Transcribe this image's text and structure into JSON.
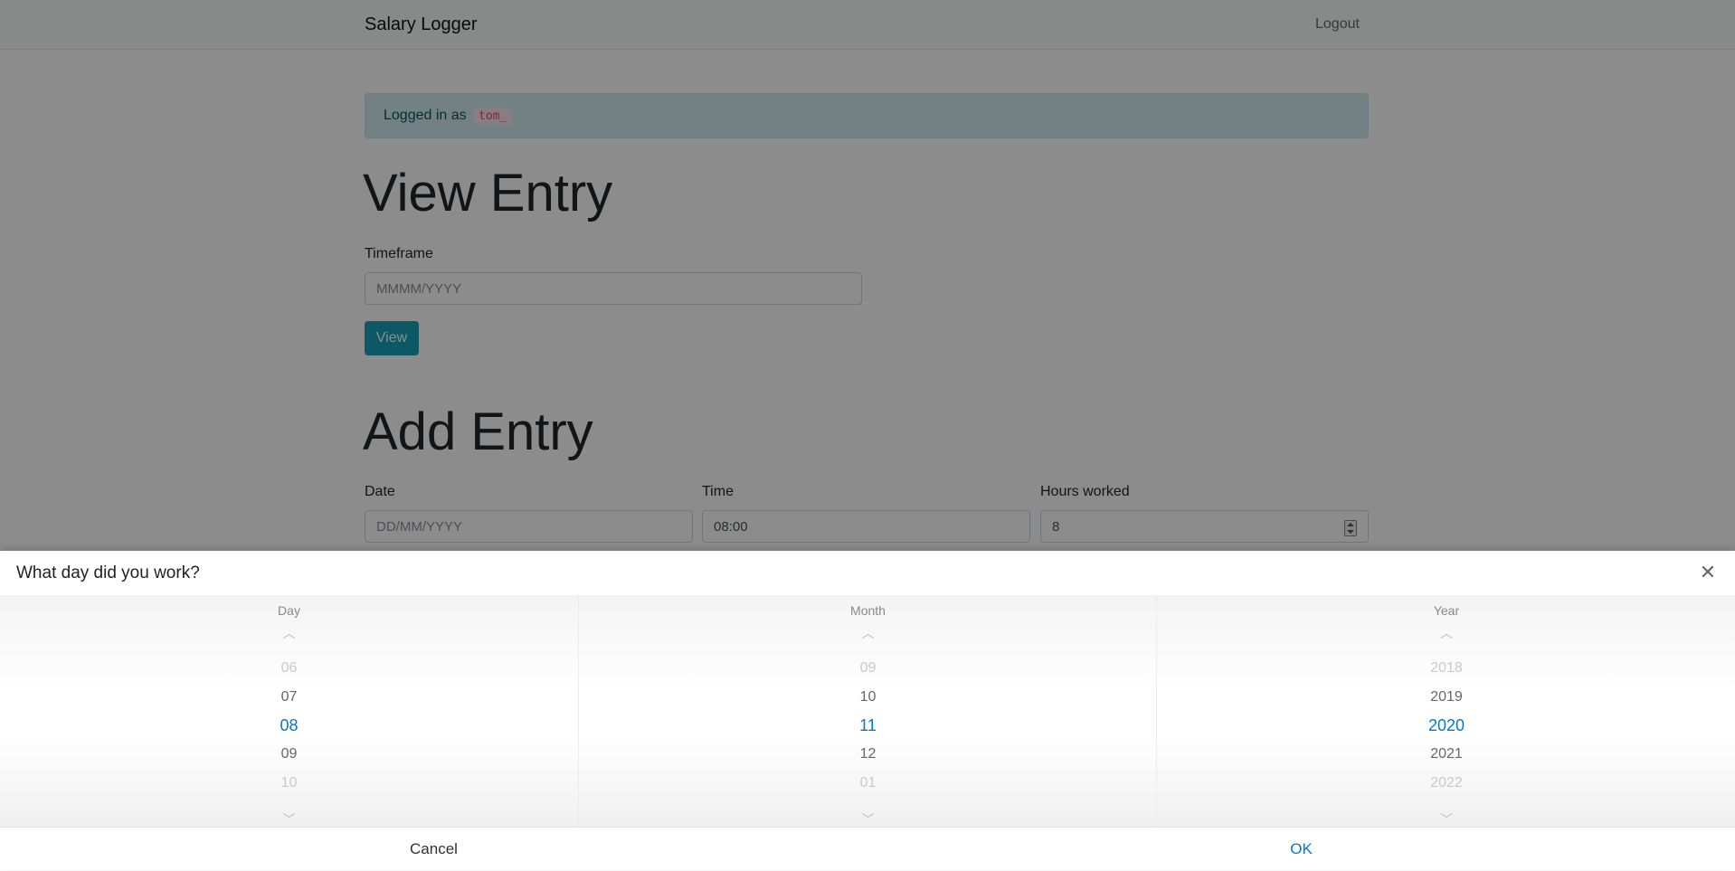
{
  "navbar": {
    "brand": "Salary Logger",
    "logout": "Logout"
  },
  "alert": {
    "prefix": "Logged in as",
    "username": "tom_"
  },
  "view_entry": {
    "title": "View Entry",
    "timeframe_label": "Timeframe",
    "timeframe_placeholder": "MMMM/YYYY",
    "view_button": "View"
  },
  "add_entry": {
    "title": "Add Entry",
    "date_label": "Date",
    "date_placeholder": "DD/MM/YYYY",
    "time_label": "Time",
    "time_value": "08:00",
    "hours_label": "Hours worked",
    "hours_value": "8"
  },
  "picker": {
    "title": "What day did you work?",
    "close_icon": "close-icon",
    "columns": [
      {
        "header": "Day",
        "items": [
          "06",
          "07",
          "08",
          "09",
          "10"
        ],
        "selected": "08"
      },
      {
        "header": "Month",
        "items": [
          "09",
          "10",
          "11",
          "12",
          "01"
        ],
        "selected": "11"
      },
      {
        "header": "Year",
        "items": [
          "2018",
          "2019",
          "2020",
          "2021",
          "2022"
        ],
        "selected": "2020"
      }
    ],
    "cancel": "Cancel",
    "ok": "OK"
  },
  "colors": {
    "accent": "#0078d4",
    "button": "#17a2b8",
    "alert_bg": "#d1ecf1",
    "overlay": "rgba(0,0,0,0.45)"
  }
}
